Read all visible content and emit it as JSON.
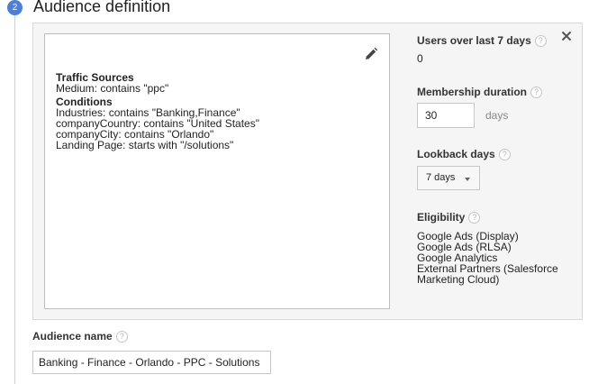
{
  "step": {
    "number": "2",
    "title": "Audience definition"
  },
  "summary": {
    "traffic_heading": "Traffic Sources",
    "traffic_lines": [
      "Medium: contains \"ppc\""
    ],
    "conditions_heading": "Conditions",
    "condition_lines": [
      "Industries: contains \"Banking,Finance\"",
      "companyCountry: contains \"United States\"",
      "companyCity: contains \"Orlando\"",
      "Landing Page: starts with \"/solutions\""
    ],
    "edit_icon": "pencil-icon"
  },
  "side": {
    "users": {
      "label": "Users over last 7 days",
      "value": "0"
    },
    "membership": {
      "label": "Membership duration",
      "value": "30",
      "unit": "days"
    },
    "lookback": {
      "label": "Lookback days",
      "selected": "7 days"
    },
    "eligibility": {
      "label": "Eligibility",
      "items": [
        "Google Ads (Display)",
        "Google Ads (RLSA)",
        "Google Analytics",
        "External Partners (Salesforce",
        "Marketing Cloud)"
      ]
    },
    "help_glyph": "?",
    "close_icon": "close-icon"
  },
  "audience_name": {
    "label": "Audience name",
    "value": "Banking - Finance - Orlando - PPC - Solutions"
  },
  "colors": {
    "step_badge": "#4a7fe0",
    "panel_bg": "#f5f5f5",
    "border": "#bdbdbd"
  }
}
